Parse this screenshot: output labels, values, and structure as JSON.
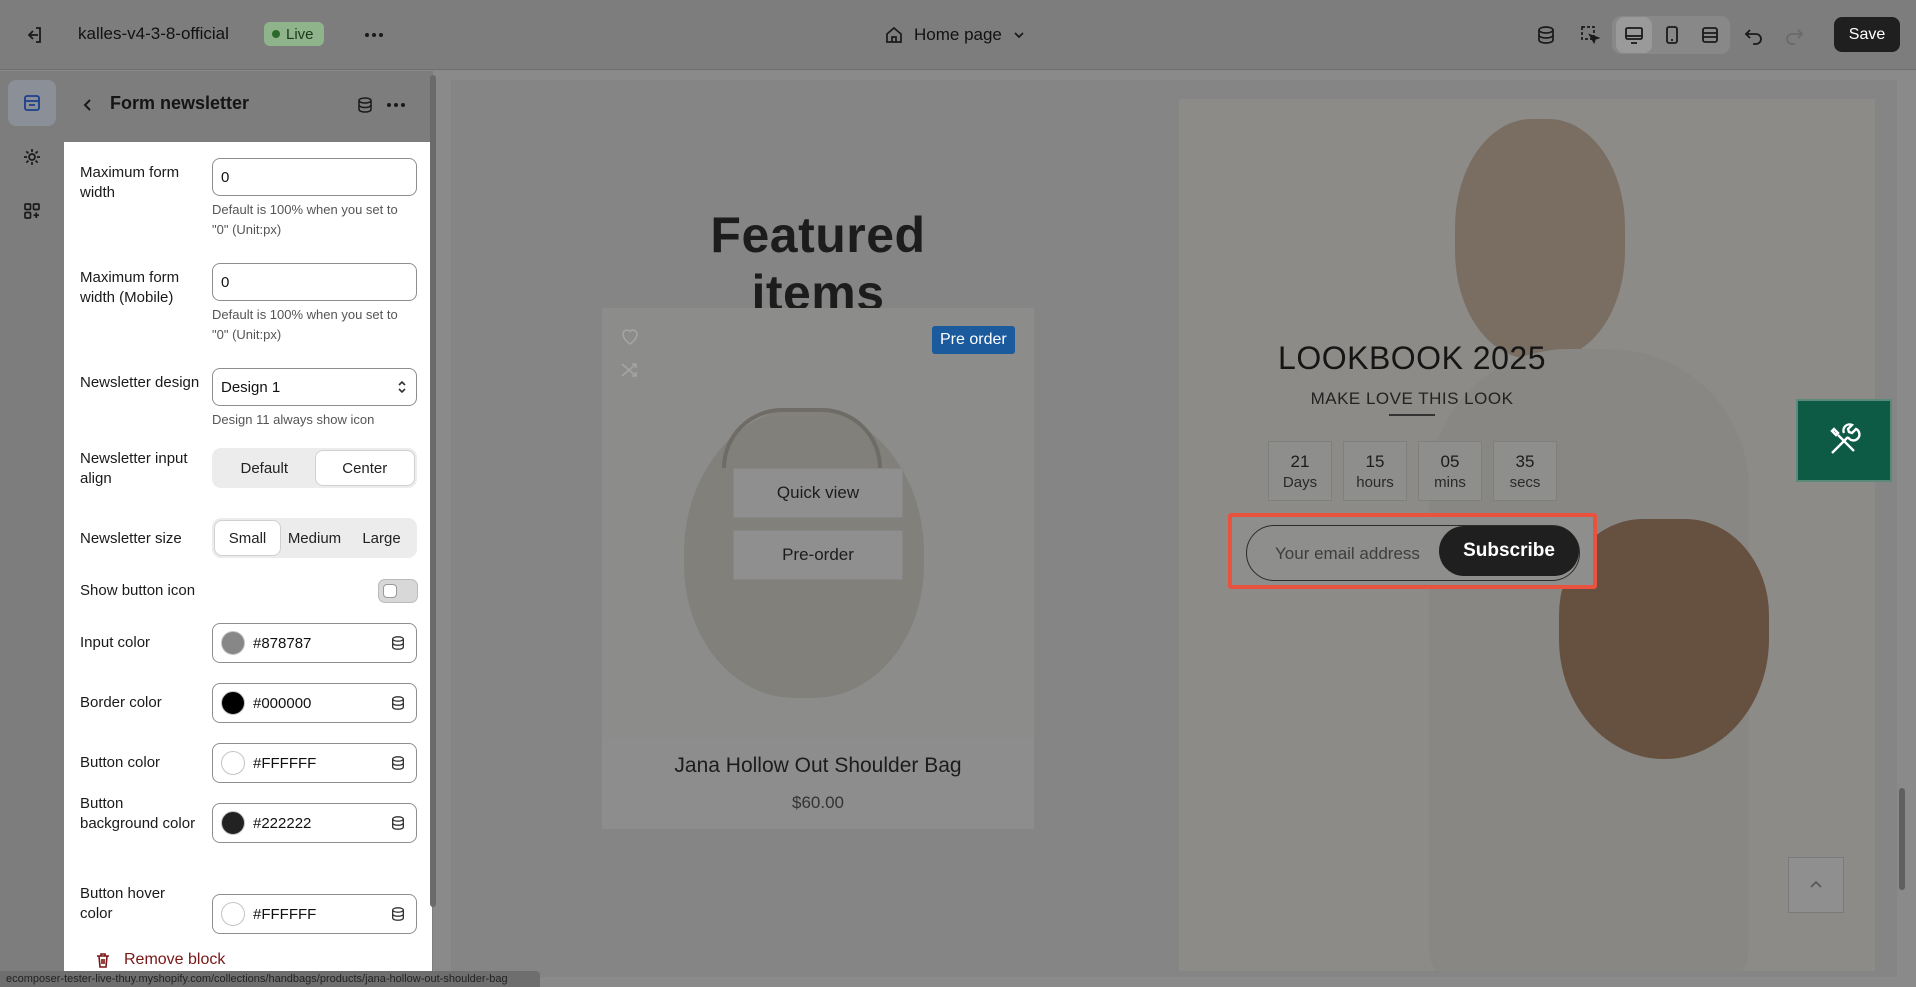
{
  "topbar": {
    "store_name": "kalles-v4-3-8-official",
    "live_label": "Live",
    "page_label": "Home page",
    "save_label": "Save"
  },
  "panel": {
    "title": "Form newsletter",
    "max_form_width": {
      "label": "Maximum form width",
      "value": "0",
      "help": "Default is 100% when you set to \"0\" (Unit:px)"
    },
    "max_form_width_mobile": {
      "label": "Maximum form width (Mobile)",
      "value": "0",
      "help": "Default is 100% when you set to \"0\" (Unit:px)"
    },
    "newsletter_design": {
      "label": "Newsletter design",
      "value": "Design 1",
      "help": "Design 11 always show icon"
    },
    "input_align": {
      "label": "Newsletter input align",
      "options": [
        "Default",
        "Center"
      ],
      "selected": "Center"
    },
    "size": {
      "label": "Newsletter size",
      "options": [
        "Small",
        "Medium",
        "Large"
      ],
      "selected": "Small"
    },
    "show_button_icon": {
      "label": "Show button icon",
      "on": false
    },
    "colors": [
      {
        "label": "Input color",
        "hex": "#878787"
      },
      {
        "label": "Border color",
        "hex": "#000000"
      },
      {
        "label": "Button color",
        "hex": "#FFFFFF"
      },
      {
        "label": "Button background color",
        "hex": "#222222"
      },
      {
        "label": "Button hover color",
        "hex": "#FFFFFF"
      }
    ],
    "remove_label": "Remove block"
  },
  "preview": {
    "featured_title": "Featured items",
    "product": {
      "badge": "Pre order",
      "quick_view": "Quick view",
      "pre_order": "Pre-order",
      "name": "Jana Hollow Out Shoulder Bag",
      "price": "$60.00"
    },
    "lookbook": {
      "title": "LOOKBOOK 2025",
      "subtitle": "MAKE LOVE THIS LOOK",
      "countdown": [
        {
          "num": "21",
          "unit": "Days"
        },
        {
          "num": "15",
          "unit": "hours"
        },
        {
          "num": "05",
          "unit": "mins"
        },
        {
          "num": "35",
          "unit": "secs"
        }
      ],
      "email_placeholder": "Your email address",
      "subscribe_label": "Subscribe"
    }
  },
  "status_url": "ecomposer-tester-live-thuy.myshopify.com/collections/handbags/products/jana-hollow-out-shoulder-bag",
  "accent_colors": {
    "live": "#2c6a2a",
    "highlight": "#e8523f",
    "badge": "#1c5a9e",
    "fab": "#0d5a45"
  }
}
